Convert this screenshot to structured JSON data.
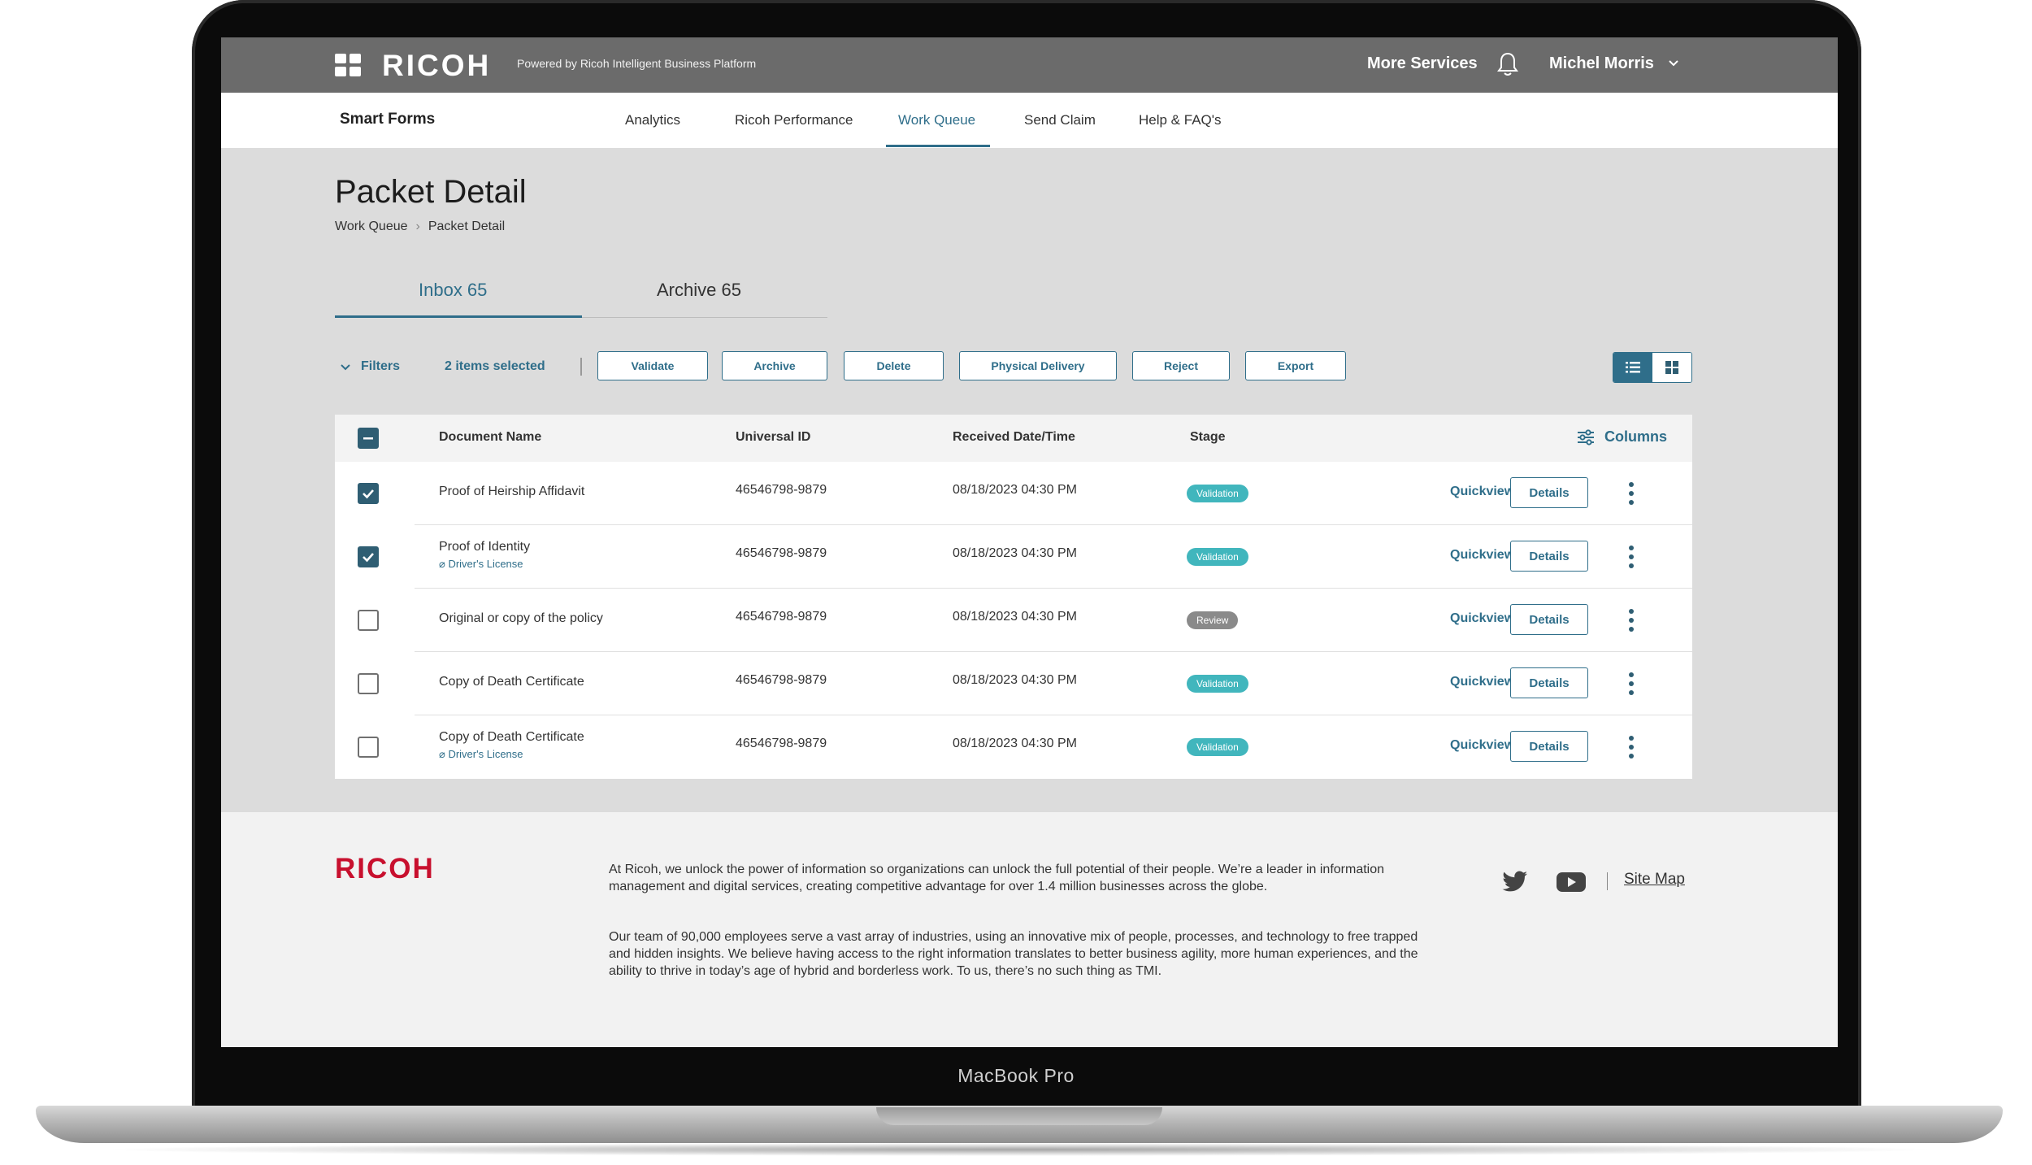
{
  "device": {
    "label": "MacBook Pro"
  },
  "topbar": {
    "brand": "RICOH",
    "powered_by": "Powered by Ricoh Intelligent Business Platform",
    "more_services": "More Services",
    "user_name": "Michel Morris",
    "icons": [
      "apps-grid-icon",
      "bell-icon",
      "chevron-down-icon"
    ]
  },
  "nav": {
    "product": "Smart Forms",
    "tabs": [
      "Analytics",
      "Ricoh Performance",
      "Work Queue",
      "Send Claim",
      "Help & FAQ's"
    ],
    "active_tab": "Work Queue"
  },
  "page": {
    "title": "Packet Detail",
    "breadcrumb": [
      "Work Queue",
      "Packet Detail"
    ]
  },
  "inbox_tabs": [
    {
      "label": "Inbox 65",
      "active": true
    },
    {
      "label": "Archive 65",
      "active": false
    }
  ],
  "toolbar": {
    "filters_label": "Filters",
    "selected_label": "2 items selected",
    "actions": [
      "Validate",
      "Archive",
      "Delete",
      "Physical Delivery",
      "Reject",
      "Export"
    ],
    "view_mode": "list"
  },
  "table": {
    "columns": [
      "Document Name",
      "Universal ID",
      "Received Date/Time",
      "Stage"
    ],
    "columns_button": "Columns",
    "quickview_label": "Quickview",
    "details_label": "Details",
    "rows": [
      {
        "checked": true,
        "name": "Proof of Heirship Affidavit",
        "attachment": "",
        "id": "46546798-9879",
        "received": "08/18/2023 04:30 PM",
        "stage": "Validation"
      },
      {
        "checked": true,
        "name": "Proof of Identity",
        "attachment": "Driver's License",
        "id": "46546798-9879",
        "received": "08/18/2023 04:30 PM",
        "stage": "Validation"
      },
      {
        "checked": false,
        "name": "Original or copy of the policy",
        "attachment": "",
        "id": "46546798-9879",
        "received": "08/18/2023 04:30 PM",
        "stage": "Review"
      },
      {
        "checked": false,
        "name": "Copy of Death Certificate",
        "attachment": "",
        "id": "46546798-9879",
        "received": "08/18/2023 04:30 PM",
        "stage": "Validation"
      },
      {
        "checked": false,
        "name": "Copy of Death Certificate",
        "attachment": "Driver's License",
        "id": "46546798-9879",
        "received": "08/18/2023 04:30 PM",
        "stage": "Validation"
      }
    ],
    "stage_colors": {
      "Validation": "#41b6bd",
      "Review": "#8a8a8a"
    }
  },
  "footer": {
    "logo": "RICOH",
    "paragraphs": [
      "At Ricoh, we unlock the power of information so organizations can unlock the full potential of their people. We’re a leader in information management and digital services, creating competitive advantage for over 1.4 million businesses across the globe.",
      "Our team of 90,000 employees serve a vast array of industries, using an innovative mix of people, processes, and technology to free trapped and hidden insights. We believe having access to the right information translates to better business agility, more human experiences, and the ability to thrive in today’s age of hybrid and borderless work. To us, there’s no such thing as TMI."
    ],
    "social": [
      "twitter-icon",
      "youtube-icon"
    ],
    "site_map": "Site Map"
  },
  "colors": {
    "accent": "#2f6e8a",
    "brand_red": "#c8102e",
    "topbar": "#6b6b6b"
  }
}
